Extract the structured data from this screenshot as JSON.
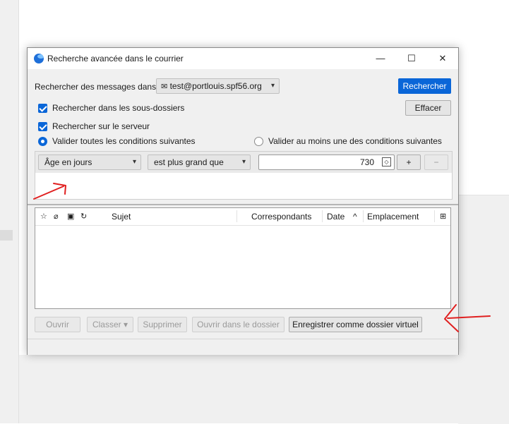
{
  "dialog": {
    "title": "Recherche avancée dans le courrier",
    "window_controls": {
      "minimize": "—",
      "maximize": "☐",
      "close": "✕"
    }
  },
  "search": {
    "search_in_label": "Rechercher des messages dans :",
    "account": "test@portlouis.spf56.org",
    "search_button": "Rechercher",
    "clear_button": "Effacer",
    "subfolders_label": "Rechercher dans les sous-dossiers",
    "subfolders_checked": true,
    "server_label": "Rechercher sur le serveur",
    "server_checked": true,
    "match_all_label": "Valider toutes les conditions suivantes",
    "match_any_label": "Valider au moins une des conditions suivantes",
    "match_mode": "all"
  },
  "condition": {
    "field": "Âge en jours",
    "operator": "est plus grand que",
    "value": "730",
    "add_button": "+",
    "remove_button": "−"
  },
  "results": {
    "columns": [
      "Sujet",
      "Correspondants",
      "Date",
      "Emplacement"
    ],
    "sort_indicator": "^",
    "icon_columns": [
      "star-icon",
      "attachment-icon",
      "junk-icon",
      "thread-icon"
    ],
    "rows": []
  },
  "actions": {
    "open": "Ouvrir",
    "file": "Classer",
    "delete": "Supprimer",
    "open_in_folder": "Ouvrir dans le dossier",
    "save_virtual": "Enregistrer comme dossier virtuel"
  },
  "colors": {
    "accent": "#0a66d8",
    "annotation": "#e02020"
  }
}
